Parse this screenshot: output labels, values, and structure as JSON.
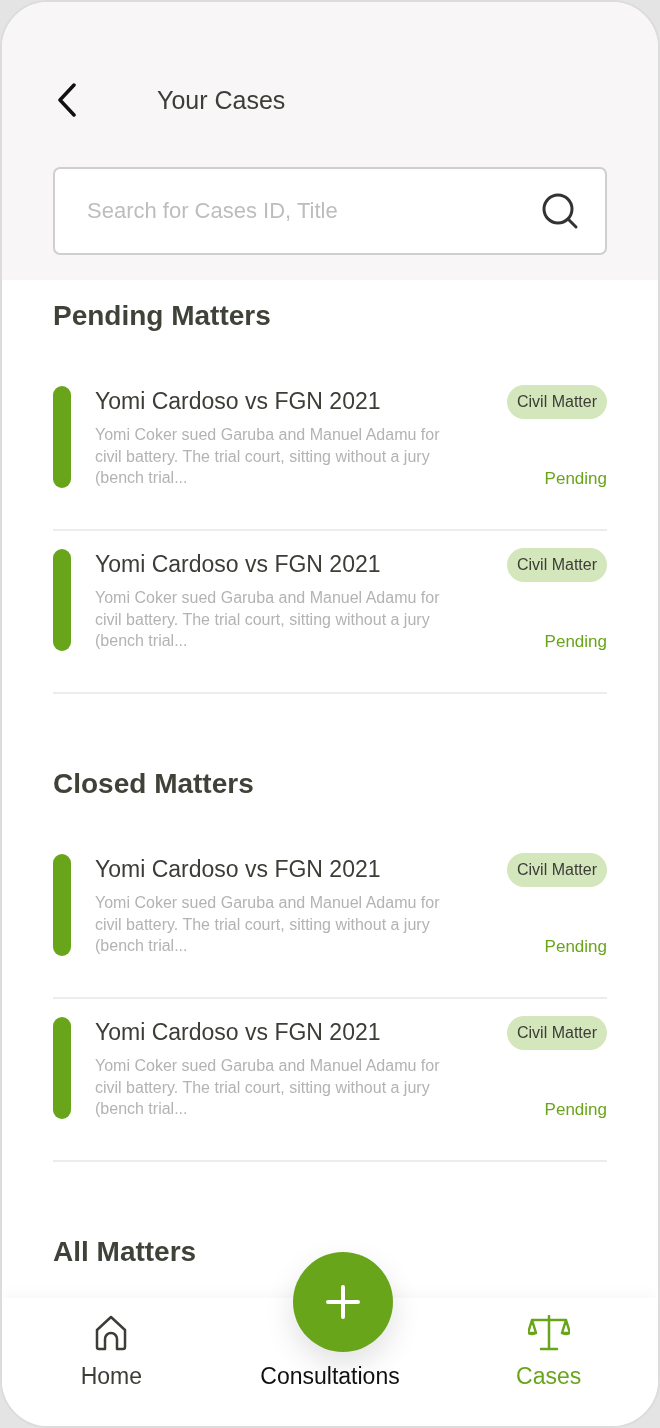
{
  "header": {
    "title": "Your Cases"
  },
  "search": {
    "placeholder": "Search for Cases ID, Title"
  },
  "sections": [
    {
      "title": "Pending Matters",
      "cases": [
        {
          "title": "Yomi Cardoso vs FGN 2021",
          "description": "Yomi Coker sued Garuba and Manuel Adamu for civil battery.  The trial court, sitting without a jury (bench trial...",
          "tag": "Civil Matter",
          "status": "Pending"
        },
        {
          "title": "Yomi Cardoso vs FGN 2021",
          "description": "Yomi Coker sued Garuba and Manuel Adamu for civil battery.  The trial court, sitting without a jury (bench trial...",
          "tag": "Civil Matter",
          "status": "Pending"
        }
      ]
    },
    {
      "title": "Closed Matters",
      "cases": [
        {
          "title": "Yomi Cardoso vs FGN 2021",
          "description": "Yomi Coker sued Garuba and Manuel Adamu for civil battery.  The trial court, sitting without a jury (bench trial...",
          "tag": "Civil Matter",
          "status": "Pending"
        },
        {
          "title": "Yomi Cardoso vs FGN 2021",
          "description": "Yomi Coker sued Garuba and Manuel Adamu for civil battery.  The trial court, sitting without a jury (bench trial...",
          "tag": "Civil Matter",
          "status": "Pending"
        }
      ]
    },
    {
      "title": "All Matters"
    }
  ],
  "nav": [
    {
      "kind": "home",
      "label": "Home",
      "selected": false
    },
    {
      "kind": "add",
      "label": "Consultations",
      "selected": false
    },
    {
      "kind": "cases",
      "label": "Cases",
      "selected": true
    }
  ]
}
